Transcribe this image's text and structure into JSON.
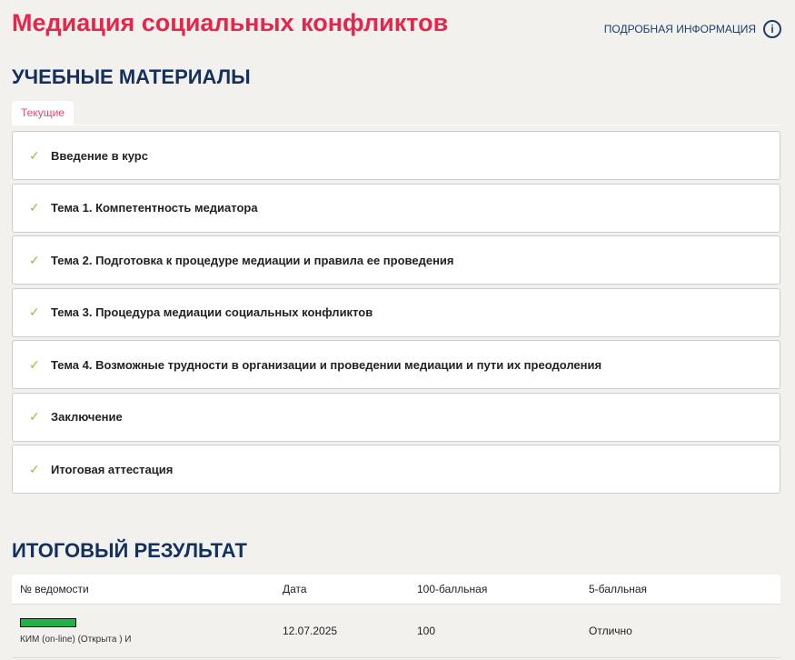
{
  "header": {
    "title": "Медиация социальных конфликтов",
    "info_link": "ПОДРОБНАЯ ИНФОРМАЦИЯ",
    "info_icon": "i"
  },
  "materials": {
    "heading": "УЧЕБНЫЕ МАТЕРИАЛЫ",
    "tab": "Текущие",
    "check": "✓",
    "items": [
      "Введение в курс",
      "Тема 1. Компетентность медиатора",
      "Тема 2. Подготовка к процедуре медиации и правила ее проведения",
      "Тема 3. Процедура медиации социальных конфликтов",
      "Тема 4. Возможные трудности в организации и проведении медиации и пути их преодоления",
      "Заключение",
      "Итоговая аттестация"
    ]
  },
  "result": {
    "heading": "ИТОГОВЫЙ РЕЗУЛЬТАТ",
    "columns": [
      "№ ведомости",
      "Дата",
      "100-балльная",
      "5-балльная"
    ],
    "rows": [
      {
        "progress": 1.0,
        "name": "КИМ (on-line) (Открыта ) И",
        "date": "12.07.2025",
        "score100": "100",
        "score5": "Отлично"
      }
    ]
  },
  "colors": {
    "accent": "#e5264a",
    "navy": "#13305e",
    "check": "#8cc63f",
    "bar": "#22b04b"
  }
}
